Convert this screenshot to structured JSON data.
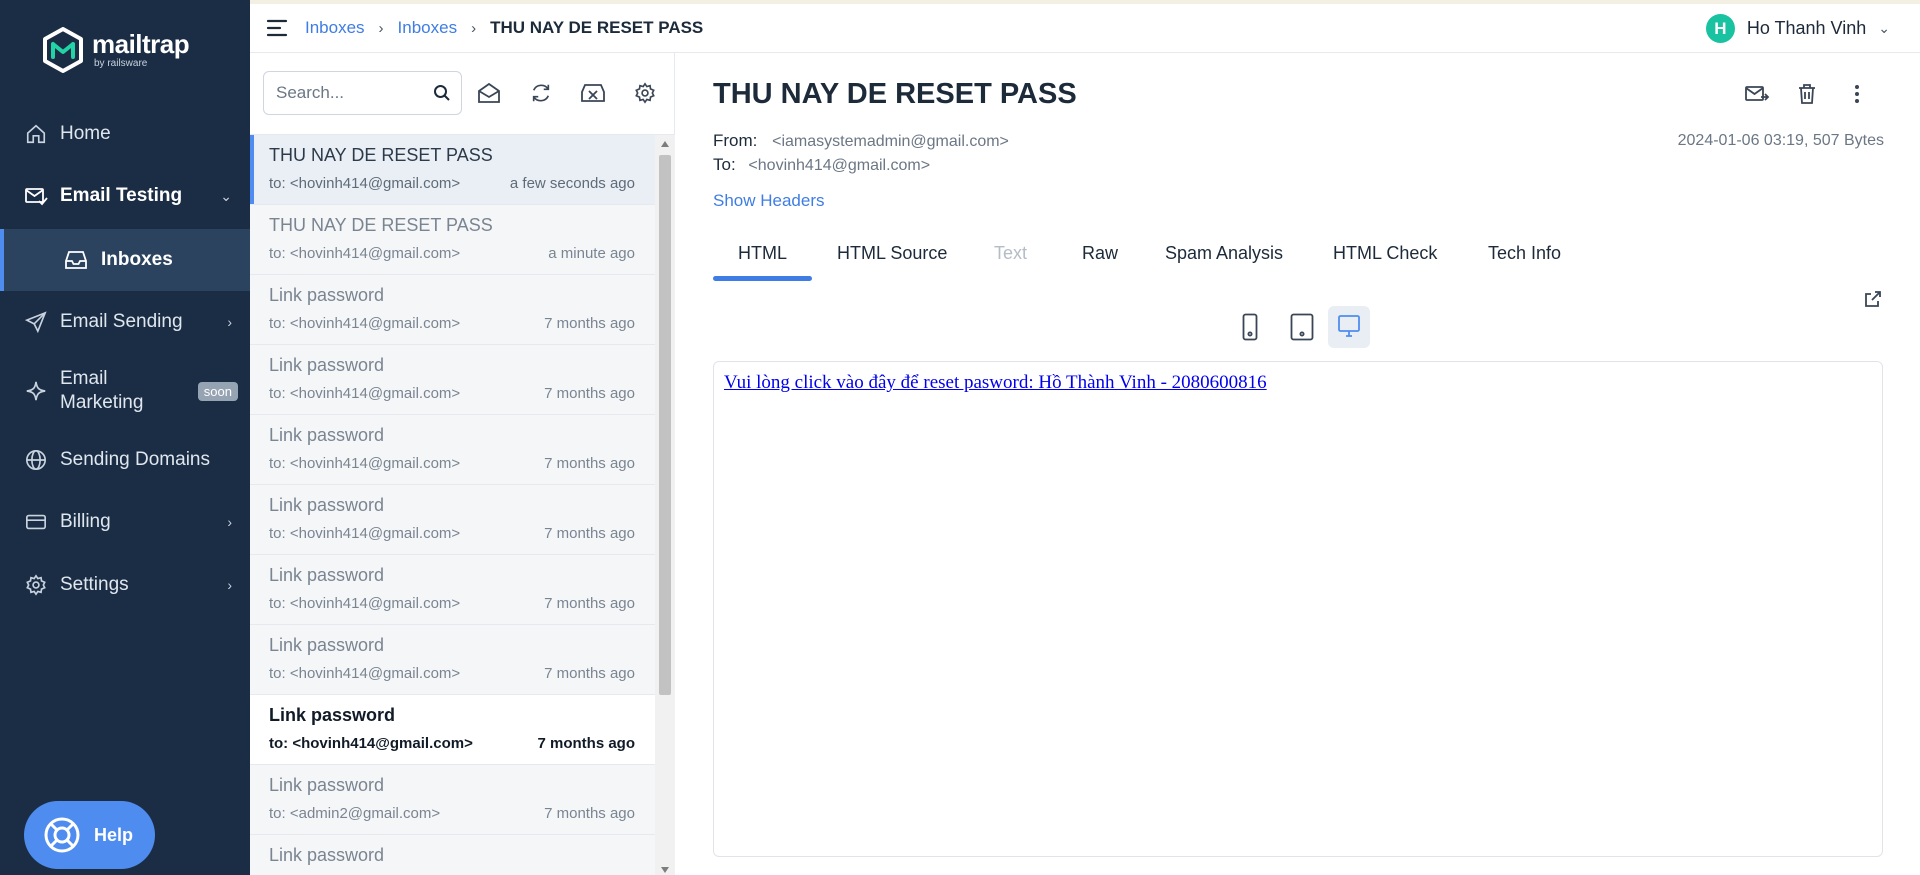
{
  "colors": {
    "sidebar_bg": "#1b2d44",
    "accent": "#4f8cf0",
    "link": "#3f7de4",
    "avatar": "#19c2a0"
  },
  "sidebar": {
    "logo": {
      "name": "mailtrap",
      "sub": "by railsware"
    },
    "items": [
      {
        "label": "Home",
        "icon": "home-icon"
      },
      {
        "label": "Email Testing",
        "icon": "email-testing-icon",
        "expanded": true
      },
      {
        "label": "Inboxes",
        "icon": "inbox-icon",
        "active": true
      },
      {
        "label": "Email Sending",
        "icon": "send-icon"
      },
      {
        "label": "Email Marketing",
        "icon": "sparkle-icon",
        "badge": "soon"
      },
      {
        "label": "Sending Domains",
        "icon": "globe-icon"
      },
      {
        "label": "Billing",
        "icon": "card-icon"
      },
      {
        "label": "Settings",
        "icon": "gear-icon"
      }
    ],
    "help_label": "Help"
  },
  "header": {
    "breadcrumbs": [
      "Inboxes",
      "Inboxes",
      "THU NAY DE RESET PASS"
    ],
    "user": {
      "initial": "H",
      "name": "Ho Thanh Vinh"
    }
  },
  "list": {
    "search_placeholder": "Search...",
    "messages": [
      {
        "subject": "THU NAY DE RESET PASS",
        "to": "to: <hovinh414@gmail.com>",
        "time": "a few seconds ago",
        "state": "selected"
      },
      {
        "subject": "THU NAY DE RESET PASS",
        "to": "to: <hovinh414@gmail.com>",
        "time": "a minute ago",
        "state": "read"
      },
      {
        "subject": "Link password",
        "to": "to: <hovinh414@gmail.com>",
        "time": "7 months ago",
        "state": "read"
      },
      {
        "subject": "Link password",
        "to": "to: <hovinh414@gmail.com>",
        "time": "7 months ago",
        "state": "read"
      },
      {
        "subject": "Link password",
        "to": "to: <hovinh414@gmail.com>",
        "time": "7 months ago",
        "state": "read"
      },
      {
        "subject": "Link password",
        "to": "to: <hovinh414@gmail.com>",
        "time": "7 months ago",
        "state": "read"
      },
      {
        "subject": "Link password",
        "to": "to: <hovinh414@gmail.com>",
        "time": "7 months ago",
        "state": "read"
      },
      {
        "subject": "Link password",
        "to": "to: <hovinh414@gmail.com>",
        "time": "7 months ago",
        "state": "read"
      },
      {
        "subject": "Link password",
        "to": "to: <hovinh414@gmail.com>",
        "time": "7 months ago",
        "state": "unread"
      },
      {
        "subject": "Link password",
        "to": "to: <admin2@gmail.com>",
        "time": "7 months ago",
        "state": "read"
      },
      {
        "subject": "Link password",
        "to": "",
        "time": "",
        "state": "read"
      }
    ]
  },
  "message": {
    "subject": "THU NAY DE RESET PASS",
    "from_label": "From:",
    "from": "<iamasystemadmin@gmail.com>",
    "to_label": "To:",
    "to": "<hovinh414@gmail.com>",
    "date_size": "2024-01-06 03:19, 507 Bytes",
    "show_headers": "Show Headers",
    "tabs": [
      {
        "label": "HTML",
        "active": true
      },
      {
        "label": "HTML Source"
      },
      {
        "label": "Text",
        "disabled": true
      },
      {
        "label": "Raw"
      },
      {
        "label": "Spam Analysis"
      },
      {
        "label": "HTML Check"
      },
      {
        "label": "Tech Info"
      }
    ],
    "body_link": "Vui lòng click vào đây để reset pasword: Hồ Thành Vinh - 2080600816"
  }
}
